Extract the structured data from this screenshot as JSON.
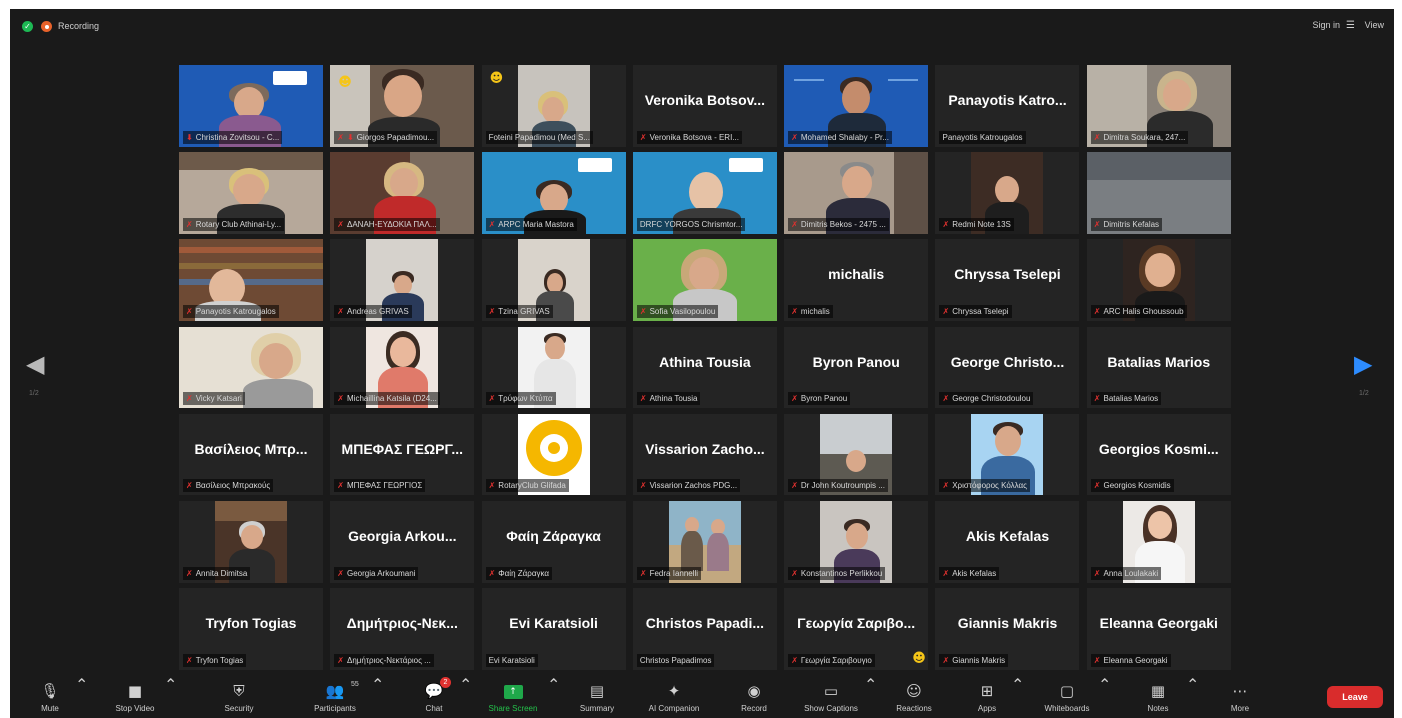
{
  "topbar": {
    "recording_label": "Recording",
    "signin_label": "Sign in",
    "view_label": "View"
  },
  "pagination": {
    "left": "1/2",
    "right": "1/2"
  },
  "participants": [
    {
      "big": "",
      "label": "Christina Zovitsou - C...",
      "icon": "pin"
    },
    {
      "big": "",
      "label": "Giorgos Papadimou...",
      "icon": "mute-pin"
    },
    {
      "big": "",
      "label": "Foteini Papadimou (Med S...",
      "icon": "none"
    },
    {
      "big": "Veronika Botsov...",
      "label": "Veronika Botsova - ERI...",
      "icon": "mute"
    },
    {
      "big": "",
      "label": "Mohamed Shalaby - Pr...",
      "icon": "mute"
    },
    {
      "big": "Panayotis Katro...",
      "label": "Panayotis Katrougalos",
      "icon": "none"
    },
    {
      "big": "",
      "label": "Dimitra Soukara, 247...",
      "icon": "mute"
    },
    {
      "big": "",
      "label": "Rotary Club Athinai-Ly...",
      "icon": "mute"
    },
    {
      "big": "",
      "label": "ΔΑΝΑΗ-ΕΥΔΟΚΙΑ ΠΑΛ...",
      "icon": "mute"
    },
    {
      "big": "",
      "label": "ARPC Maria Mastora",
      "icon": "mute"
    },
    {
      "big": "",
      "label": "DRFC YORGOS Chrismtor...",
      "icon": "none"
    },
    {
      "big": "",
      "label": "Dimitris Bekos - 2475 ...",
      "icon": "mute"
    },
    {
      "big": "",
      "label": "Redmi Note 13S",
      "icon": "mute"
    },
    {
      "big": "",
      "label": "Dimitris Kefalas",
      "icon": "mute"
    },
    {
      "big": "",
      "label": "Panayotis Katrougalos",
      "icon": "mute"
    },
    {
      "big": "",
      "label": "Andreas GRIVAS",
      "icon": "mute"
    },
    {
      "big": "",
      "label": "Tzina GRIVAS",
      "icon": "mute"
    },
    {
      "big": "",
      "label": "Sofia Vasilopoulou",
      "icon": "mute"
    },
    {
      "big": "michalis",
      "label": "michalis",
      "icon": "mute"
    },
    {
      "big": "Chryssa Tselepi",
      "label": "Chryssa Tselepi",
      "icon": "mute"
    },
    {
      "big": "",
      "label": "ARC Halis Ghoussoub",
      "icon": "mute"
    },
    {
      "big": "",
      "label": "Vicky Katsari",
      "icon": "mute"
    },
    {
      "big": "",
      "label": "Michaillina Katsila (D24...",
      "icon": "mute"
    },
    {
      "big": "",
      "label": "Τρύφων Κτύπα",
      "icon": "mute"
    },
    {
      "big": "Athina Tousia",
      "label": "Athina Tousia",
      "icon": "mute"
    },
    {
      "big": "Byron Panou",
      "label": "Byron Panou",
      "icon": "mute"
    },
    {
      "big": "George Christo...",
      "label": "George Christodoulou",
      "icon": "mute"
    },
    {
      "big": "Batalias Marios",
      "label": "Batalias Marios",
      "icon": "mute"
    },
    {
      "big": "Βασίλειος Μπρ...",
      "label": "Βασίλειος Μπρακούς",
      "icon": "mute"
    },
    {
      "big": "ΜΠΕΦΑΣ ΓΕΩΡΓ...",
      "label": "ΜΠΕΦΑΣ ΓΕΩΡΓΙΟΣ",
      "icon": "mute"
    },
    {
      "big": "",
      "label": "RotaryClub Glifada",
      "icon": "mute"
    },
    {
      "big": "Vissarion Zacho...",
      "label": "Vissarion Zachos PDG...",
      "icon": "mute"
    },
    {
      "big": "",
      "label": "Dr John Koutroumpis ...",
      "icon": "mute"
    },
    {
      "big": "",
      "label": "Χριστόφορος Κόλλας",
      "icon": "mute"
    },
    {
      "big": "Georgios Kosmi...",
      "label": "Georgios Kosmidis",
      "icon": "mute"
    },
    {
      "big": "",
      "label": "Annita Dimitsa",
      "icon": "mute"
    },
    {
      "big": "Georgia Arkou...",
      "label": "Georgia Arkoumani",
      "icon": "mute"
    },
    {
      "big": "Φαίη Ζάραγκα",
      "label": "Φαίη Ζάραγκα",
      "icon": "mute"
    },
    {
      "big": "",
      "label": "Fedra Iannelli",
      "icon": "mute"
    },
    {
      "big": "",
      "label": "Konstantinos Perlikkou",
      "icon": "mute"
    },
    {
      "big": "Akis Kefalas",
      "label": "Akis Kefalas",
      "icon": "mute"
    },
    {
      "big": "",
      "label": "Anna Loulakaki",
      "icon": "mute"
    },
    {
      "big": "Tryfon Togias",
      "label": "Tryfon Togias",
      "icon": "mute"
    },
    {
      "big": "Δημήτριος-Νεκ...",
      "label": "Δημήτριος-Νεκτάριος ...",
      "icon": "mute"
    },
    {
      "big": "Evi Karatsioli",
      "label": "Evi Karatsioli",
      "icon": "none"
    },
    {
      "big": "Christos Papadi...",
      "label": "Christos Papadimos",
      "icon": "none"
    },
    {
      "big": "Γεωργία Σαριβο...",
      "label": "Γεωργία Σαριβουγιο",
      "icon": "mute"
    },
    {
      "big": "Giannis Makris",
      "label": "Giannis Makris",
      "icon": "mute"
    },
    {
      "big": "Eleanna Georgaki",
      "label": "Eleanna Georgaki",
      "icon": "mute"
    }
  ],
  "toolbar": {
    "mute": "Mute",
    "stop_video": "Stop Video",
    "security": "Security",
    "participants": "Participants",
    "participants_count": "55",
    "chat": "Chat",
    "chat_badge": "2",
    "share_screen": "Share Screen",
    "summary": "Summary",
    "ai_companion": "AI Companion",
    "record": "Record",
    "show_captions": "Show Captions",
    "reactions": "Reactions",
    "apps": "Apps",
    "whiteboards": "Whiteboards",
    "notes": "Notes",
    "more": "More",
    "leave": "Leave"
  },
  "colors": {
    "accent": "#2d8cff",
    "active_speaker": "#c5e06b",
    "leave": "#d92c2c",
    "share": "#1fa84a",
    "muted": "#e0312f"
  }
}
